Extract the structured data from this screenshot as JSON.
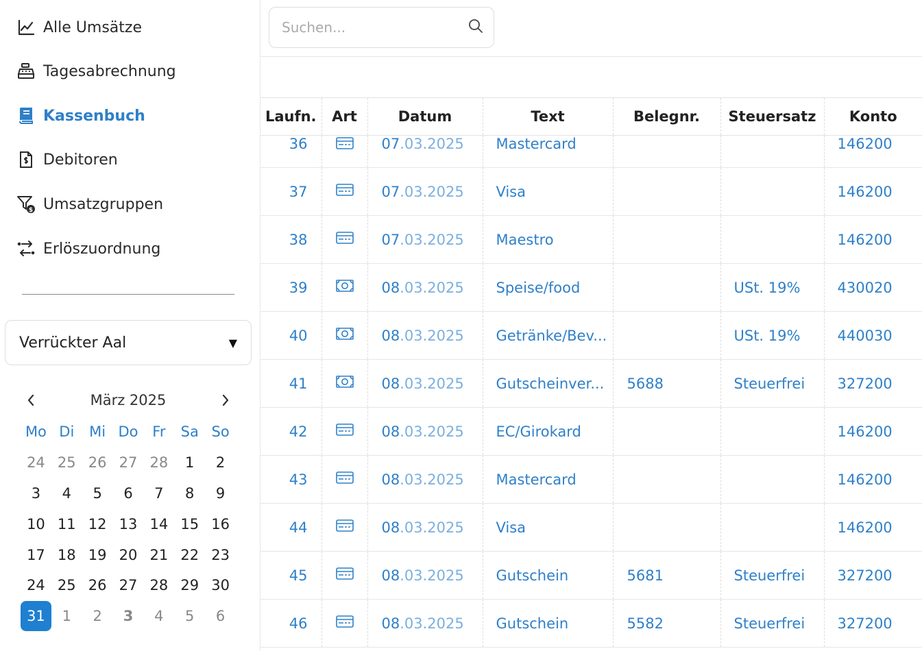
{
  "nav": {
    "items": [
      {
        "label": "Alle Umsätze",
        "icon": "line-chart-icon"
      },
      {
        "label": "Tagesabrechnung",
        "icon": "cash-register-icon"
      },
      {
        "label": "Kassenbuch",
        "icon": "book-icon"
      },
      {
        "label": "Debitoren",
        "icon": "invoice-dollar-icon"
      },
      {
        "label": "Umsatzgruppen",
        "icon": "filter-dollar-icon"
      },
      {
        "label": "Erlöszuordnung",
        "icon": "arrows-swap-icon"
      }
    ],
    "active": "Kassenbuch"
  },
  "location_select": {
    "value": "Verrückter Aal"
  },
  "calendar": {
    "month_label": "März 2025",
    "weekdays": [
      "Mo",
      "Di",
      "Mi",
      "Do",
      "Fr",
      "Sa",
      "So"
    ],
    "weeks": [
      [
        "24",
        "25",
        "26",
        "27",
        "28",
        "1",
        "2"
      ],
      [
        "3",
        "4",
        "5",
        "6",
        "7",
        "8",
        "9"
      ],
      [
        "10",
        "11",
        "12",
        "13",
        "14",
        "15",
        "16"
      ],
      [
        "17",
        "18",
        "19",
        "20",
        "21",
        "22",
        "23"
      ],
      [
        "24",
        "25",
        "26",
        "27",
        "28",
        "29",
        "30"
      ],
      [
        "31",
        "1",
        "2",
        "3",
        "4",
        "5",
        "6"
      ]
    ],
    "selected_day": "31"
  },
  "search": {
    "placeholder": "Suchen..."
  },
  "table": {
    "headers": [
      "Laufn.",
      "Art",
      "Datum",
      "Text",
      "Belegnr.",
      "Steuersatz",
      "Konto"
    ],
    "rows": [
      {
        "laufn": "36",
        "art": "card-icon",
        "day": "07",
        "rest": ".03.2025",
        "text": "Mastercard",
        "beleg": "",
        "steuer": "",
        "konto": "146200"
      },
      {
        "laufn": "37",
        "art": "card-icon",
        "day": "07",
        "rest": ".03.2025",
        "text": "Visa",
        "beleg": "",
        "steuer": "",
        "konto": "146200"
      },
      {
        "laufn": "38",
        "art": "card-icon",
        "day": "07",
        "rest": ".03.2025",
        "text": "Maestro",
        "beleg": "",
        "steuer": "",
        "konto": "146200"
      },
      {
        "laufn": "39",
        "art": "cash-icon",
        "day": "08",
        "rest": ".03.2025",
        "text": "Speise/food",
        "beleg": "",
        "steuer": "USt. 19%",
        "konto": "430020"
      },
      {
        "laufn": "40",
        "art": "cash-icon",
        "day": "08",
        "rest": ".03.2025",
        "text": "Getränke/Bev...",
        "beleg": "",
        "steuer": "USt. 19%",
        "konto": "440030"
      },
      {
        "laufn": "41",
        "art": "cash-icon",
        "day": "08",
        "rest": ".03.2025",
        "text": "Gutscheinver...",
        "beleg": "5688",
        "steuer": "Steuerfrei",
        "konto": "327200"
      },
      {
        "laufn": "42",
        "art": "card-icon",
        "day": "08",
        "rest": ".03.2025",
        "text": "EC/Girokard",
        "beleg": "",
        "steuer": "",
        "konto": "146200"
      },
      {
        "laufn": "43",
        "art": "card-icon",
        "day": "08",
        "rest": ".03.2025",
        "text": "Mastercard",
        "beleg": "",
        "steuer": "",
        "konto": "146200"
      },
      {
        "laufn": "44",
        "art": "card-icon",
        "day": "08",
        "rest": ".03.2025",
        "text": "Visa",
        "beleg": "",
        "steuer": "",
        "konto": "146200"
      },
      {
        "laufn": "45",
        "art": "card-icon",
        "day": "08",
        "rest": ".03.2025",
        "text": "Gutschein",
        "beleg": "5681",
        "steuer": "Steuerfrei",
        "konto": "327200"
      },
      {
        "laufn": "46",
        "art": "card-icon",
        "day": "08",
        "rest": ".03.2025",
        "text": "Gutschein",
        "beleg": "5582",
        "steuer": "Steuerfrei",
        "konto": "327200"
      }
    ]
  },
  "colors": {
    "accent": "#2f80c8",
    "date_light": "#7ab0dd",
    "today_bg": "#1f7fd1"
  }
}
